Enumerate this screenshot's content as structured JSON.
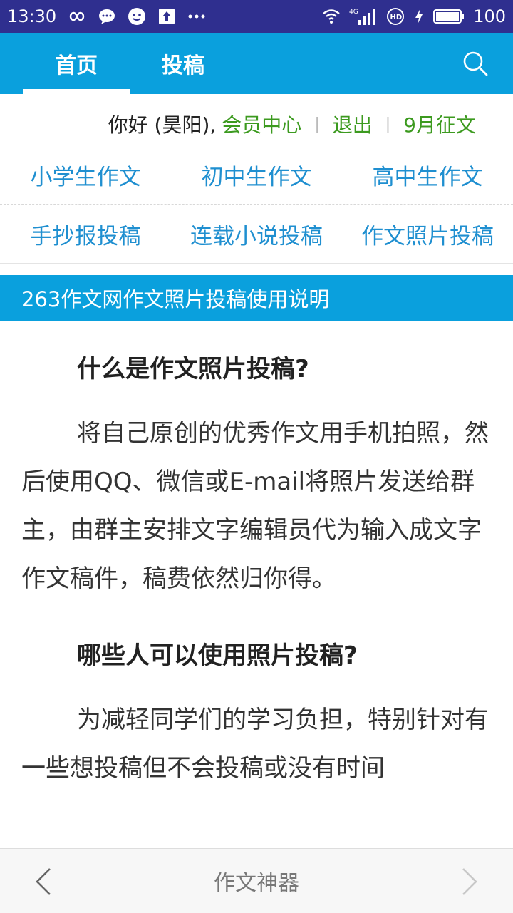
{
  "status_bar": {
    "time": "13:30",
    "network": "4G",
    "battery": "100",
    "icons": [
      "infinity-icon",
      "chat-bubble-icon",
      "wechat-icon",
      "upload-icon",
      "more-dots-icon",
      "wifi-icon",
      "signal-icon",
      "hd-icon",
      "charging-icon",
      "battery-icon"
    ]
  },
  "top_nav": {
    "tabs": [
      {
        "label": "首页"
      },
      {
        "label": "投稿"
      }
    ],
    "active_index": 0,
    "accent": "#0aa0dd"
  },
  "user_bar": {
    "greeting": "你好 (昊阳),",
    "member_center": "会员中心",
    "logout": "退出",
    "contest": "9月征文",
    "separator": "|",
    "link_color": "#3c9a1f"
  },
  "categories": [
    [
      "小学生作文",
      "初中生作文",
      "高中生作文"
    ],
    [
      "手抄报投稿",
      "连载小说投稿",
      "作文照片投稿"
    ]
  ],
  "section_title": "263作文网作文照片投稿使用说明",
  "article": {
    "q1": "什么是作文照片投稿?",
    "a1": "将自己原创的优秀作文用手机拍照，然后使用QQ、微信或E-mail将照片发送给群主，由群主安排文字编辑员代为输入成文字作文稿件，稿费依然归你得。",
    "q2": "哪些人可以使用照片投稿?",
    "a2": "为减轻同学们的学习负担，特别针对有一些想投稿但不会投稿或没有时间"
  },
  "bottom_bar": {
    "title": "作文神器"
  }
}
